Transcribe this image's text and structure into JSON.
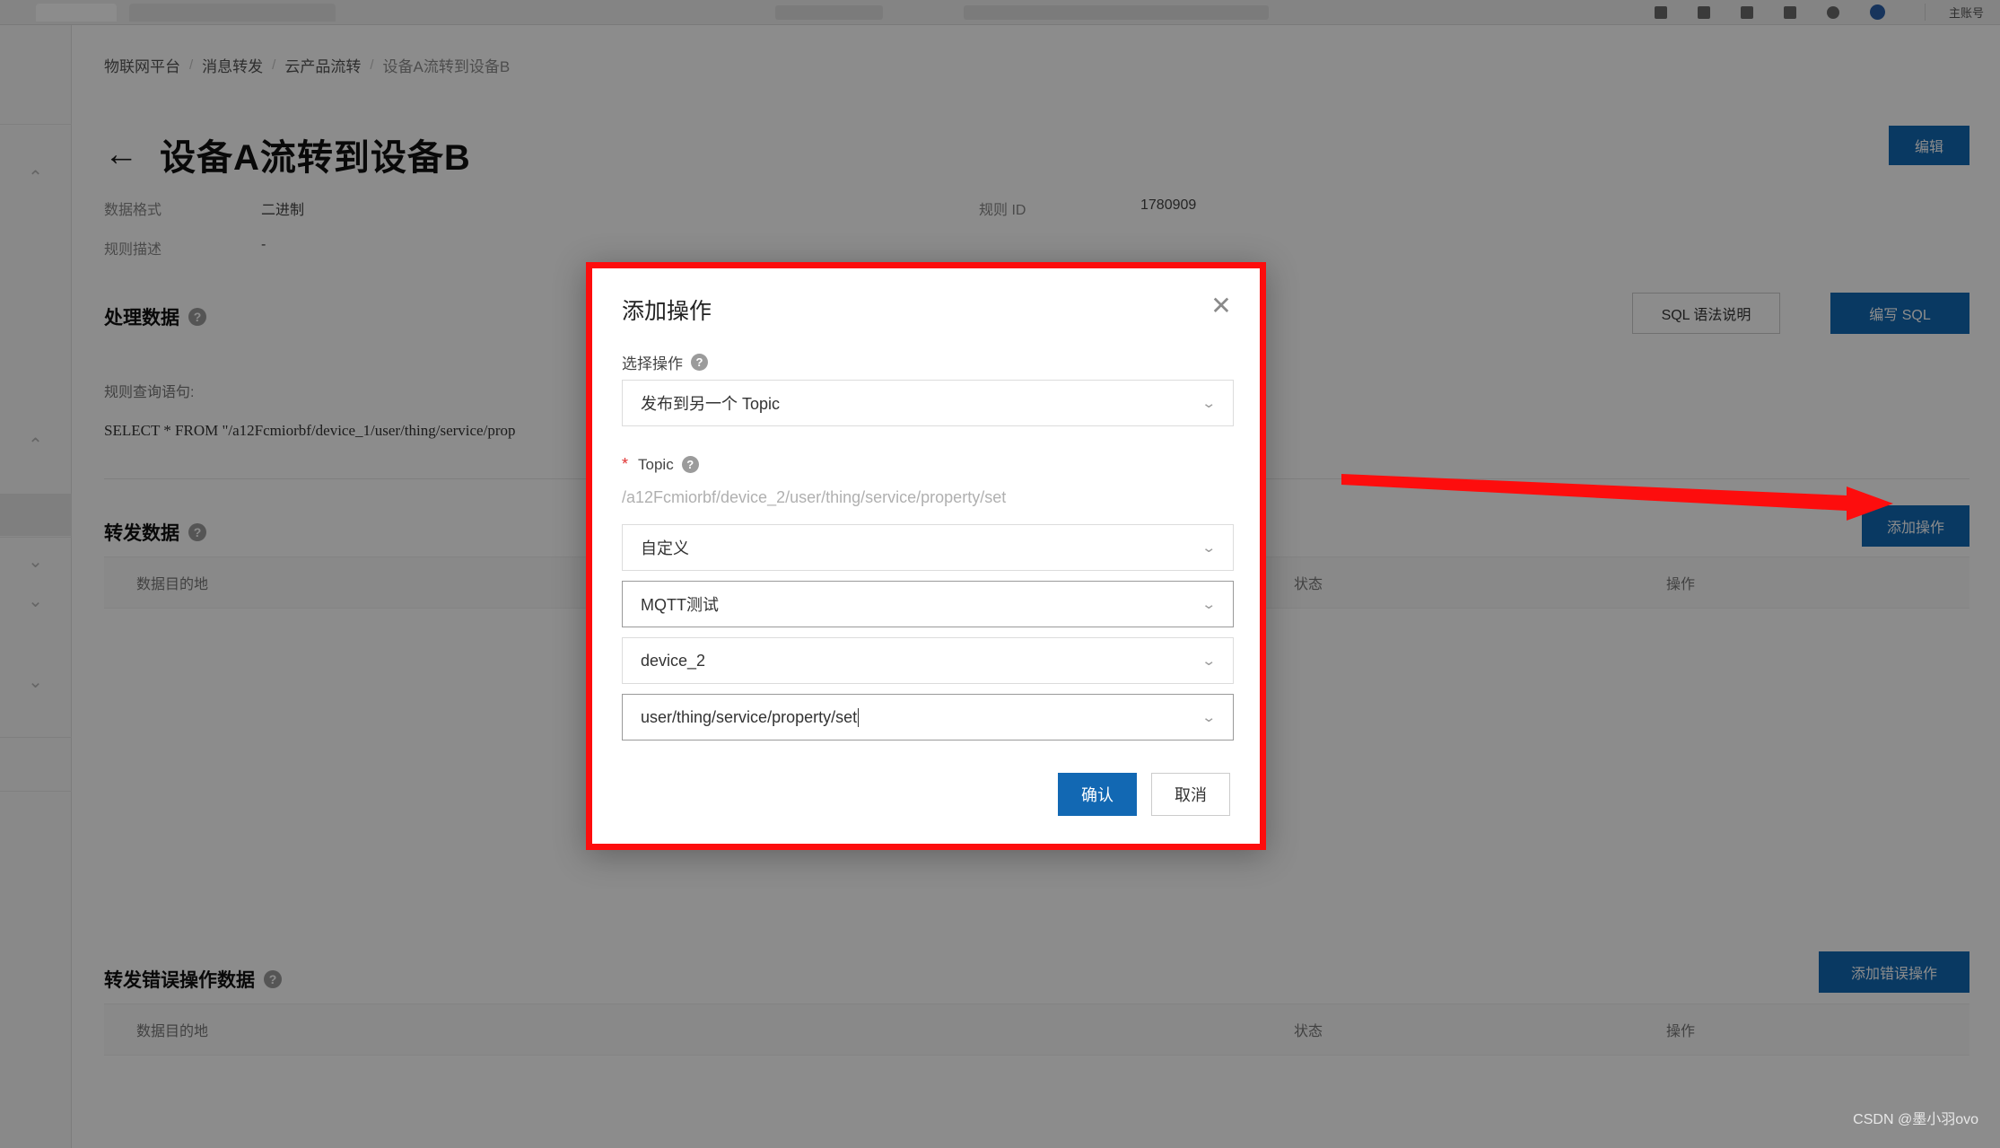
{
  "topbar": {
    "account_label": "主账号",
    "icons": [
      "window-icon",
      "save-icon",
      "bookmark-icon",
      "puzzle-icon",
      "clock-icon",
      "profile-avatar-icon"
    ]
  },
  "breadcrumb": {
    "items": [
      "物联网平台",
      "消息转发",
      "云产品流转",
      "设备A流转到设备B"
    ],
    "separator": "/"
  },
  "header": {
    "back_icon": "←",
    "title": "设备A流转到设备B",
    "edit_label": "编辑"
  },
  "meta": {
    "format_label": "数据格式",
    "format_value": "二进制",
    "rule_id_label": "规则 ID",
    "rule_id_value": "1780909",
    "desc_label": "规则描述",
    "desc_value": "-"
  },
  "process_section": {
    "title": "处理数据",
    "help_icon": "?",
    "sql_syntax_label": "SQL 语法说明",
    "write_sql_label": "编写 SQL",
    "query_label": "规则查询语句:",
    "query_sql": "SELECT * FROM \"/a12Fcmiorbf/device_1/user/thing/service/prop"
  },
  "forward_section": {
    "title": "转发数据",
    "help_icon": "?",
    "add_action_label": "添加操作",
    "columns": [
      "数据目的地",
      "状态",
      "操作"
    ]
  },
  "error_section": {
    "title": "转发错误操作数据",
    "help_icon": "?",
    "add_error_action_label": "添加错误操作",
    "columns": [
      "数据目的地",
      "状态",
      "操作"
    ]
  },
  "modal": {
    "title": "添加操作",
    "close_icon": "✕",
    "action_label": "选择操作",
    "action_help_icon": "?",
    "action_value": "发布到另一个 Topic",
    "topic_label": "Topic",
    "topic_required_mark": "*",
    "topic_help_icon": "?",
    "topic_preview": "/a12Fcmiorbf/device_2/user/thing/service/property/set",
    "fields": [
      {
        "value": "自定义",
        "chevron": "⌄",
        "focused": false
      },
      {
        "value": "MQTT测试",
        "chevron": "⌄",
        "focused": true
      },
      {
        "value": "device_2",
        "chevron": "⌄",
        "focused": false
      },
      {
        "value": "user/thing/service/property/set",
        "chevron": "⌄",
        "focused": true
      }
    ],
    "confirm_label": "确认",
    "cancel_label": "取消"
  },
  "watermark": {
    "text": "CSDN @墨小羽ovo"
  },
  "colors": {
    "primary": "#1268b3",
    "annotation_red": "#fd0d0d",
    "required_red": "#e03131"
  }
}
